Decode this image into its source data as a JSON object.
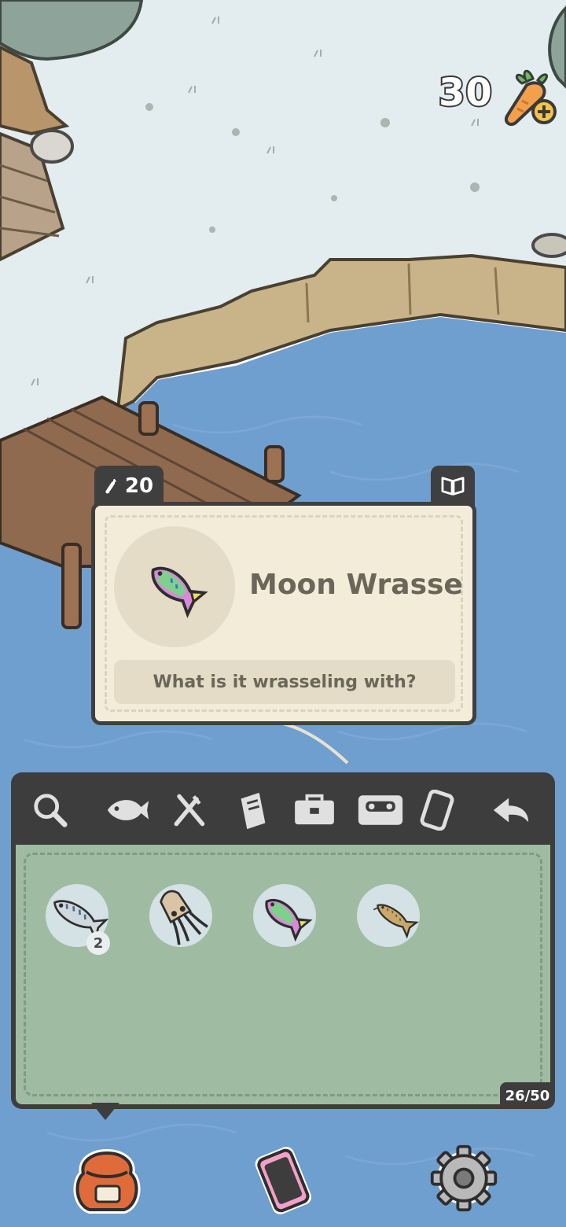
{
  "hud": {
    "carrot_count": "30",
    "add_carrots_icon": "carrot-plus-icon"
  },
  "fish_popup": {
    "price": "20",
    "price_icon": "carrot-icon",
    "journal_icon": "book-icon",
    "name": "Moon Wrasse",
    "description": "What is it wrasseling with?"
  },
  "toolbar": {
    "tools": [
      "search-icon",
      "fish-icon",
      "fork-knife-icon",
      "journal-icon",
      "toolbox-icon",
      "cassette-icon",
      "phone-icon",
      "back-arrow-icon"
    ]
  },
  "inventory": {
    "capacity": "26/50",
    "items": [
      {
        "icon": "mackerel-icon",
        "count": "2"
      },
      {
        "icon": "squid-icon",
        "count": ""
      },
      {
        "icon": "moon-wrasse-icon",
        "count": ""
      },
      {
        "icon": "catfish-icon",
        "count": ""
      }
    ]
  },
  "bottom_nav": [
    "bag-icon",
    "phone-icon",
    "settings-gear-icon"
  ],
  "colors": {
    "panel_dark": "#3d3d3d",
    "inventory_green": "#9fbca2",
    "card_cream": "#f3ecd9",
    "water": "#6f9fcf",
    "snow": "#e3ecef"
  }
}
